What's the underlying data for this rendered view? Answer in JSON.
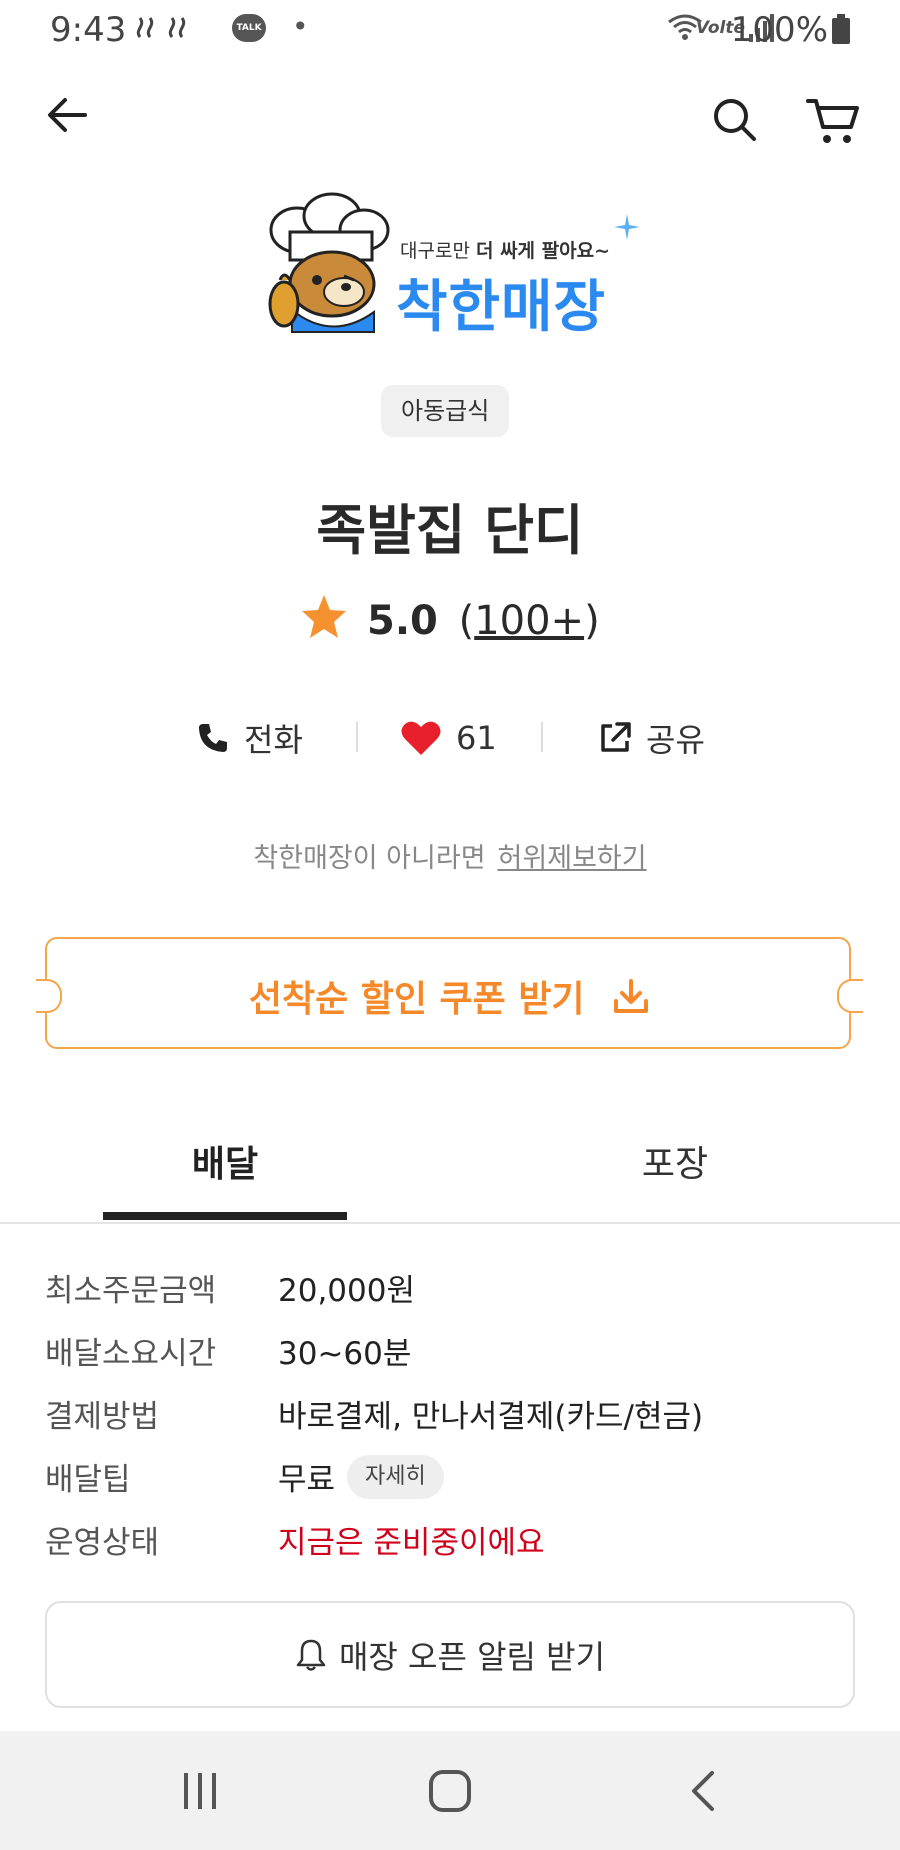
{
  "status_bar": {
    "time": "9:43",
    "talk_badge": "TALK",
    "dot": "•",
    "network": "Volte",
    "battery": "100%"
  },
  "header": {
    "back_icon": "arrow-left-icon",
    "search_icon": "search-icon",
    "cart_icon": "cart-icon"
  },
  "logo": {
    "tagline_prefix": "대구로만 ",
    "tagline_bold": "더 싸게 팔아요~",
    "title": "착한매장"
  },
  "store": {
    "category": "아동급식",
    "name": "족발집 단디",
    "rating": "5.0",
    "review_count_open": "(",
    "review_count": "100+",
    "review_count_close": ")",
    "colors": {
      "accent": "#f5892a",
      "star": "#f5922f",
      "heart": "#e8202c",
      "blue": "#2b8af0",
      "red": "#d0021b"
    }
  },
  "actions": {
    "call_label": "전화",
    "like_count": "61",
    "share_label": "공유"
  },
  "report": {
    "text": "착한매장이 아니라면",
    "link": "허위제보하기"
  },
  "coupon": {
    "label": "선착순 할인 쿠폰 받기"
  },
  "tabs": [
    {
      "label": "배달",
      "active": true
    },
    {
      "label": "포장",
      "active": false
    }
  ],
  "info": {
    "min_order_label": "최소주문금액",
    "min_order_value": "20,000원",
    "delivery_time_label": "배달소요시간",
    "delivery_time_value": "30~60분",
    "payment_label": "결제방법",
    "payment_value": "바로결제, 만나서결제(카드/현금)",
    "tip_label": "배달팁",
    "tip_value": "무료",
    "tip_detail": "자세히",
    "status_label": "운영상태",
    "status_value": "지금은 준비중이에요"
  },
  "notify": {
    "label": "매장 오픈 알림 받기"
  },
  "navbar": {
    "recent_icon": "recent-apps-icon",
    "home_icon": "home-icon",
    "back_icon": "nav-back-icon"
  }
}
